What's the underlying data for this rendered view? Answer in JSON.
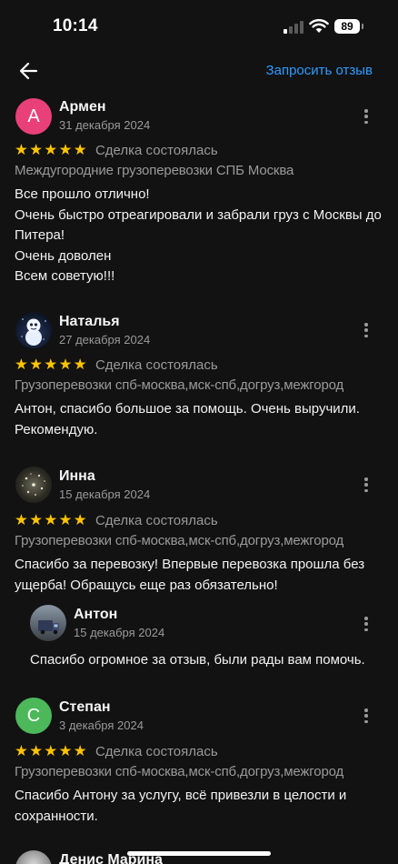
{
  "status_bar": {
    "time": "10:14",
    "battery": "89"
  },
  "header": {
    "request_review_label": "Запросить отзыв"
  },
  "deal_status_label": "Сделка состоялась",
  "stars": "★★★★★",
  "reviews": [
    {
      "author": "Армен",
      "initial": "А",
      "avatar_color": "#e9407a",
      "date": "31 декабря 2024",
      "service": "Междугородние грузоперевозки СПБ Москва",
      "text": "Все прошло отлично!\nОчень быстро отреагировали и забрали груз с Москвы до Питера!\nОчень доволен\nВсем советую!!!"
    },
    {
      "author": "Наталья",
      "date": "27 декабря 2024",
      "service": "Грузоперевозки спб-москва,мск-спб,догруз,межгород",
      "text": "Антон, спасибо большое за помощь. Очень выручили. Рекомендую."
    },
    {
      "author": "Инна",
      "date": "15 декабря 2024",
      "service": "Грузоперевозки спб-москва,мск-спб,догруз,межгород",
      "text": "Спасибо за перевозку! Впервые перевозка прошла без ущерба! Обращусь еще раз обязательно!",
      "reply": {
        "author": "Антон",
        "date": "15 декабря 2024",
        "text": "Спасибо огромное за отзыв, были рады вам помочь."
      }
    },
    {
      "author": "Степан",
      "initial": "С",
      "avatar_color": "#4cb85a",
      "date": "3 декабря 2024",
      "service": "Грузоперевозки спб-москва,мск-спб,догруз,межгород",
      "text": "Спасибо Антону за услугу, всё привезли в целости и сохранности."
    },
    {
      "author": "Денис Марина"
    }
  ],
  "colors": {
    "accent": "#2f9bff",
    "star": "#ffc400",
    "background": "#121212",
    "secondary_text": "#9a9a9a"
  }
}
